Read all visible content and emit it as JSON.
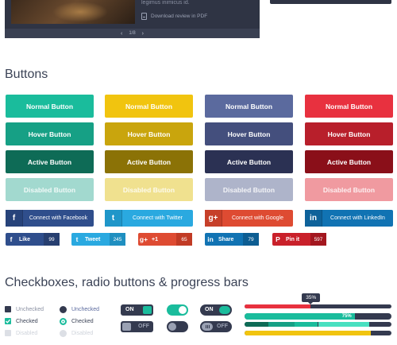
{
  "top_panel": {
    "intro_text": "legimus inimicus id.",
    "download_label": "Download review in PDF",
    "pager": {
      "prev": "‹",
      "text": "1/8",
      "next": "›"
    }
  },
  "sections": {
    "buttons_title": "Buttons",
    "checks_title": "Checkboxes, radio buttons & progress bars"
  },
  "button_states": [
    "Normal Button",
    "Hover Button",
    "Active Button",
    "Disabled Button"
  ],
  "button_colors": {
    "teal": [
      "#1abc9c",
      "#16a085",
      "#0e6b56",
      "#a2d9cf"
    ],
    "yellow": [
      "#f1c40f",
      "#c9a50d",
      "#8b7206",
      "#f0e18f"
    ],
    "indigo": [
      "#5b6a9e",
      "#444f7d",
      "#2b3153",
      "#aeb4ca"
    ],
    "red": [
      "#e8313f",
      "#b81f2b",
      "#8a0f19",
      "#f09aa0"
    ]
  },
  "social": [
    {
      "name": "facebook",
      "label": "Connect with Facebook",
      "icon": "f",
      "color": "#2f4e8c",
      "icon_bg": "#27437a"
    },
    {
      "name": "twitter",
      "label": "Connect with Twitter",
      "icon": "t",
      "color": "#2aa9e0",
      "icon_bg": "#1f96c9"
    },
    {
      "name": "google",
      "label": "Connect with Google",
      "icon": "g+",
      "color": "#de4b32",
      "icon_bg": "#c63f29"
    },
    {
      "name": "linkedin",
      "label": "Connect with LinkedIn",
      "icon": "in",
      "color": "#1173b3",
      "icon_bg": "#0e629a"
    }
  ],
  "share": [
    {
      "name": "like",
      "icon": "f",
      "label": "Like",
      "count": "99",
      "color": "#2f4e8c",
      "count_bg": "#273f70"
    },
    {
      "name": "tweet",
      "icon": "t",
      "label": "Tweet",
      "count": "245",
      "color": "#2aa9e0",
      "count_bg": "#1f8fc0"
    },
    {
      "name": "plusone",
      "icon": "g+",
      "label": "+1",
      "count": "65",
      "color": "#de4b32",
      "count_bg": "#c13b25"
    },
    {
      "name": "share",
      "icon": "in",
      "label": "Share",
      "count": "79",
      "color": "#1173b3",
      "count_bg": "#0d5d92"
    },
    {
      "name": "pinit",
      "icon": "P",
      "label": "Pin it",
      "count": "597",
      "color": "#c9202a",
      "count_bg": "#a3171f"
    }
  ],
  "checkboxes": [
    {
      "label": "Unchecked",
      "state": "unchecked"
    },
    {
      "label": "Checked",
      "state": "checked"
    },
    {
      "label": "Disabled",
      "state": "disabled"
    }
  ],
  "radios": [
    {
      "label": "Unchecked",
      "state": "unchecked"
    },
    {
      "label": "Checked",
      "state": "checked"
    },
    {
      "label": "Disabled",
      "state": "disabled"
    }
  ],
  "toggles": {
    "on": "ON",
    "off": "OFF"
  },
  "progress": {
    "bar1": {
      "fill": 0.45,
      "color": "#e8313f",
      "tooltip": "35%"
    },
    "bar2": {
      "fill": 0.75,
      "color": "#1abc9c",
      "label": "75%"
    },
    "bar3": {
      "segments": [
        0.16,
        0.34,
        0.5,
        0.85
      ],
      "colors": [
        "#0e6b56",
        "#16a085",
        "#1abc9c",
        "#48e0c0"
      ]
    },
    "bar4": {
      "fill": 0.86,
      "color": "#f1c40f"
    }
  }
}
